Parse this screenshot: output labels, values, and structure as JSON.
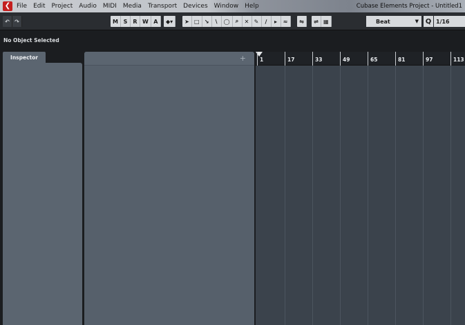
{
  "menubar": {
    "logo": "cubase-logo",
    "items": [
      "File",
      "Edit",
      "Project",
      "Audio",
      "MIDI",
      "Media",
      "Transport",
      "Devices",
      "Window",
      "Help"
    ],
    "window_title": "Cubase Elements Project - Untitled1"
  },
  "toolbar": {
    "undo_icon": "undo-icon",
    "redo_icon": "redo-icon",
    "msrwa": [
      "M",
      "S",
      "R",
      "W",
      "A"
    ],
    "tools": [
      "object-select-icon",
      "range-select-icon",
      "split-icon",
      "glue-icon",
      "erase-icon",
      "zoom-icon",
      "mute-icon",
      "draw-icon",
      "line-icon",
      "play-icon",
      "time-warp-icon"
    ],
    "snap_select": "Beat",
    "quantize_label": "Q",
    "quantize_value": "1/16"
  },
  "infoline": {
    "text": "No Object Selected"
  },
  "inspector": {
    "tab_label": "Inspector"
  },
  "tracklist": {
    "add_label": "+"
  },
  "ruler": {
    "bars": [
      "1",
      "17",
      "33",
      "49",
      "65",
      "81",
      "97",
      "113"
    ]
  }
}
